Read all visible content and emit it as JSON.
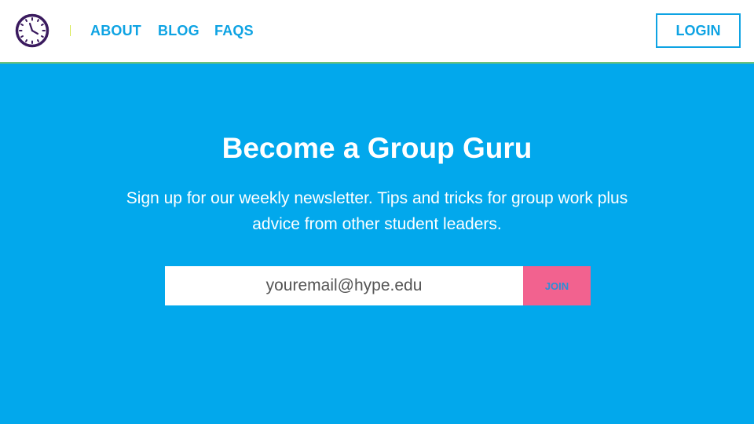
{
  "nav": {
    "logo_icon": "clock-icon",
    "links": [
      "ABOUT",
      "BLOG",
      "FAQS"
    ],
    "login_label": "LOGIN"
  },
  "hero": {
    "title": "Become a Group Guru",
    "description_line1": "Sign up for our weekly newsletter. Tips and tricks for group work plus",
    "description_line2": "advice from other student leaders."
  },
  "signup": {
    "email_placeholder": "youremail@hype.edu",
    "join_label": "JOIN"
  },
  "colors": {
    "background": "#02a8ec",
    "nav_link": "#0ea3e3",
    "join_button": "#f2628f",
    "logo": "#3a1a5e"
  }
}
